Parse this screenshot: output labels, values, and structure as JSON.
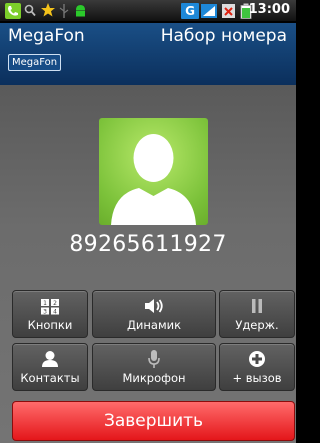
{
  "status_bar": {
    "network_type": "G",
    "time": "13:00",
    "icons": [
      "phone-icon",
      "search-icon",
      "star-icon",
      "usb-icon",
      "android-icon",
      "network-icon",
      "signal-icon",
      "sim-icon",
      "battery-icon"
    ]
  },
  "header": {
    "operator": "MegaFon",
    "operator_badge": "MegaFon",
    "call_state": "Набор номера"
  },
  "call": {
    "number": "89265611927"
  },
  "buttons": {
    "keypad": "Кнопки",
    "speaker": "Динамик",
    "hold": "Удерж.",
    "contacts": "Контакты",
    "mute": "Микрофон",
    "add_call": "+ вызов"
  },
  "end_call": "Завершить",
  "colors": {
    "header_bg": "#0b2f5c",
    "end_button": "#e4161a",
    "avatar_bg": "#7cc23a"
  }
}
